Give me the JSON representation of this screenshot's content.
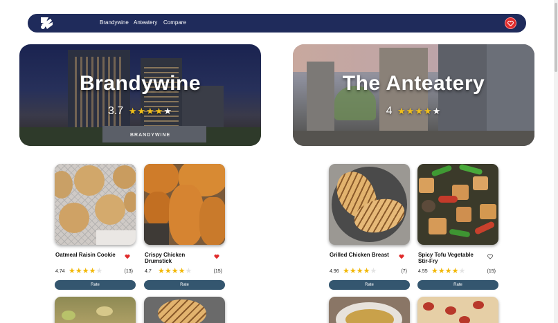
{
  "nav": {
    "links": [
      "Brandywine",
      "Anteatery",
      "Compare"
    ]
  },
  "heroes": [
    {
      "title": "Brandywine",
      "rating": "3.7",
      "stars_filled": 3.5,
      "sign": "BRANDYWINE"
    },
    {
      "title": "The Anteatery",
      "rating": "4",
      "stars_filled": 4
    }
  ],
  "items": [
    {
      "name": "Oatmeal Raisin Cookie",
      "rating": "4.74",
      "count": "(13)",
      "favorite": true,
      "button": "Rate"
    },
    {
      "name": "Crispy Chicken Drumstick",
      "rating": "4.7",
      "count": "(15)",
      "favorite": true,
      "button": "Rate"
    },
    {
      "name": "Grilled Chicken Breast",
      "rating": "4.96",
      "count": "(7)",
      "favorite": true,
      "button": "Rate"
    },
    {
      "name": "Spicy Tofu Vegetable Stir-Fry",
      "rating": "4.55",
      "count": "(15)",
      "favorite": false,
      "button": "Rate"
    }
  ],
  "colors": {
    "nav": "#1f2b5b",
    "accent_red": "#e02b2b",
    "button": "#34566f",
    "star": "#f2b705"
  },
  "icons": [
    "logo-icon",
    "heart-icon",
    "star-icon"
  ]
}
